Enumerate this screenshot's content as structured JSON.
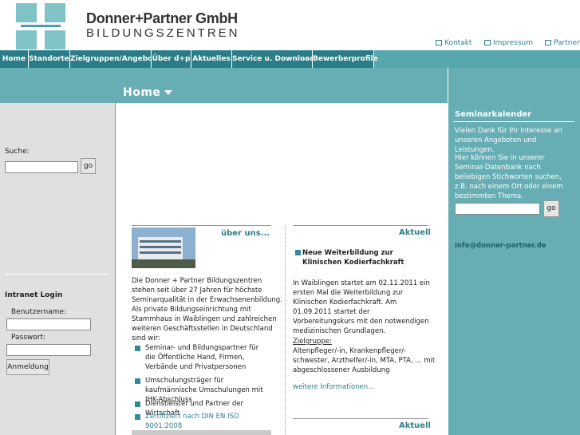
{
  "brand": {
    "name": "Donner+Partner GmbH",
    "sub": "BILDUNGSZENTREN"
  },
  "top_links": [
    {
      "label": "Kontakt",
      "icon": "mail-icon"
    },
    {
      "label": "Impressum",
      "icon": "info-icon"
    },
    {
      "label": "Partner",
      "icon": "info-icon"
    }
  ],
  "nav": [
    "Home",
    "Standorte",
    "Zielgruppen/Angebote",
    "Über d+p",
    "Aktuelles",
    "Service u. Downloads",
    "Bewerberprofile"
  ],
  "band": {
    "title": "Home"
  },
  "left": {
    "search_label": "Suche:",
    "search_button": "go",
    "intranet_title": "Intranet Login",
    "user_label": "Benutzername:",
    "pass_label": "Passwort:",
    "login_button": "Anmeldung"
  },
  "right": {
    "title": "Seminarkalender",
    "text1": "Vielen Dank für Ihr Interesse an unseren Angeboten und Leistungen.",
    "text2": "Hier können Sie in unserer Seminar-Datenbank nach beliebigen Stichworten suchen, z.B. nach einem Ort oder einem bestimmten Thema.",
    "search_button": "go",
    "email": "info@donner-partner.de"
  },
  "about": {
    "heading": "über uns...",
    "intro": "Die Donner + Partner Bildungszentren stehen seit über 27 Jahren für höchste Seminarqualität in der Erwachsenenbildung. Als private Bildungseinrichtung mit Stammhaus in Waiblingen und zahlreichen weiteren Geschäftsstellen in Deutschland sind wir:",
    "bullets": [
      "Seminar- und Bildungspartner für die Öffentliche Hand, Firmen, Verbände und Privatpersonen",
      "Umschulungsträger für kaufmännische Umschulungen mit IHK-Abschluss",
      "Dienstleister und Partner der Wirtschaft",
      "Zertifiziert nach DIN EN ISO 9001:2008"
    ]
  },
  "news": {
    "heading": "Aktuell",
    "title": "Neue Weiterbildung zur Klinischen Kodierfachkraft",
    "text": "In Waiblingen startet am 02.11.2011 ein ersten Mal die Weiterbildung zur Klinischen Kodierfachkraft. Am 01.09.2011 startet der Vorbereitungskurs mit den notwendigen medizinischen Grundlagen.",
    "target_label": "Zielgruppe:",
    "target_text": "Altenpfleger/-in, Krankenpfleger/-schwester, Arzthelfer/-in, MTA, PTA, ... mit abgeschlossener Ausbildung",
    "more": "weitere Informationen...",
    "heading2": "Aktuell"
  },
  "colors": {
    "nav_dark": "#2a7d87",
    "band": "#66aeb4",
    "link": "#2f8088"
  }
}
